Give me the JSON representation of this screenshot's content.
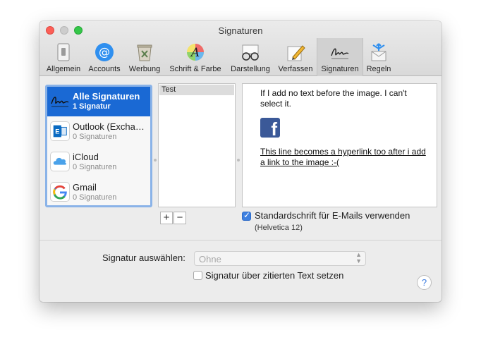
{
  "window": {
    "title": "Signaturen"
  },
  "toolbar": {
    "items": [
      {
        "label": "Allgemein",
        "icon": "switch-icon"
      },
      {
        "label": "Accounts",
        "icon": "at-sign-icon"
      },
      {
        "label": "Werbung",
        "icon": "junk-bin-icon"
      },
      {
        "label": "Schrift & Farbe",
        "icon": "font-color-icon"
      },
      {
        "label": "Darstellung",
        "icon": "glasses-icon"
      },
      {
        "label": "Verfassen",
        "icon": "pencil-icon"
      },
      {
        "label": "Signaturen",
        "icon": "signature-icon",
        "active": true
      },
      {
        "label": "Regeln",
        "icon": "rules-envelope-icon"
      }
    ]
  },
  "accounts": [
    {
      "name": "Alle Signaturen",
      "sub": "1 Signatur",
      "icon": "signature-icon",
      "selected": true
    },
    {
      "name": "Outlook (Exchan…",
      "sub": "0 Signaturen",
      "icon": "outlook-icon"
    },
    {
      "name": "iCloud",
      "sub": "0 Signaturen",
      "icon": "icloud-icon"
    },
    {
      "name": "Gmail",
      "sub": "0 Signaturen",
      "icon": "google-icon"
    }
  ],
  "signatures": [
    {
      "name": "Test"
    }
  ],
  "list_buttons": {
    "add": "+",
    "remove": "−"
  },
  "preview": {
    "text1": "If I add no text before the image. I can't select it.",
    "image_icon": "facebook-icon",
    "image_glyph": "f",
    "text2": "This line becomes a hyperlink too after i add a link to the image :-("
  },
  "default_font": {
    "label": "Standardschrift für E-Mails verwenden",
    "sub": "(Helvetica 12)",
    "checked": true
  },
  "select": {
    "label": "Signatur auswählen:",
    "value": "Ohne"
  },
  "quote": {
    "label": "Signatur über zitierten Text setzen",
    "checked": false
  },
  "help": {
    "label": "?"
  },
  "colors": {
    "selection": "#1a69d4",
    "checkbox_on": "#3c7fe0",
    "facebook": "#3b5998"
  }
}
